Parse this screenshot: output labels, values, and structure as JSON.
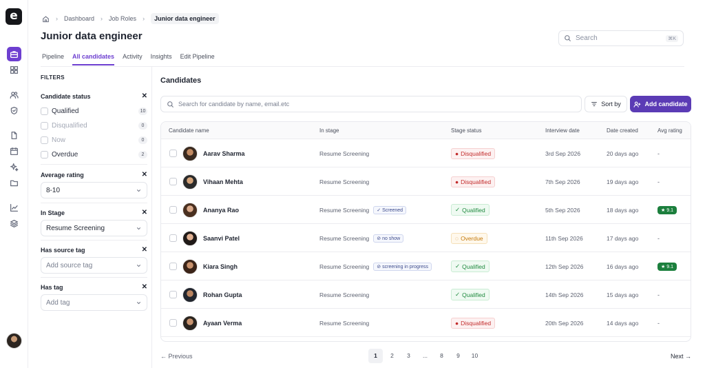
{
  "app": {
    "logo_letter": "e"
  },
  "rail": {
    "icons": [
      "briefcase-icon",
      "grid-icon",
      "users-icon",
      "shield-icon",
      "file-icon",
      "calendar-icon",
      "sparkle-icon",
      "folder-icon",
      "chart-icon",
      "layers-icon"
    ]
  },
  "breadcrumb": {
    "items": [
      "Dashboard",
      "Job Roles"
    ],
    "current": "Junior data engineer"
  },
  "page": {
    "title": "Junior data engineer"
  },
  "top_search": {
    "placeholder": "Search",
    "shortcut": "⌘K"
  },
  "tabs": [
    {
      "label": "Pipeline",
      "active": false
    },
    {
      "label": "All candidates",
      "active": true
    },
    {
      "label": "Activity",
      "active": false
    },
    {
      "label": "Insights",
      "active": false
    },
    {
      "label": "Edit Pipeline",
      "active": false
    }
  ],
  "filters": {
    "title": "FILTERS",
    "candidate_status": {
      "label": "Candidate status",
      "options": [
        {
          "label": "Qualified",
          "count": "10"
        },
        {
          "label": "Disqualified",
          "count": "0"
        },
        {
          "label": "Now",
          "count": "0"
        },
        {
          "label": "Overdue",
          "count": "2"
        }
      ]
    },
    "average_rating": {
      "label": "Average rating",
      "value": "8-10"
    },
    "in_stage": {
      "label": "In Stage",
      "value": "Resume Screening"
    },
    "source_tag": {
      "label": "Has source tag",
      "placeholder": "Add source tag"
    },
    "tag": {
      "label": "Has tag",
      "placeholder": "Add tag"
    }
  },
  "candidates": {
    "title": "Candidates",
    "search_placeholder": "Search for candidate by name, email.etc",
    "sort_label": "Sort by",
    "add_label": "Add candidate",
    "columns": [
      "Candidate name",
      "In stage",
      "Stage status",
      "Interview date",
      "Date created",
      "Avg rating"
    ],
    "rows": [
      {
        "name": "Aarav Sharma",
        "stage": "Resume Screening",
        "tag": "",
        "status": "Disqualified",
        "status_kind": "dq",
        "interview": "3rd Sep 2026",
        "created": "20 days ago",
        "rating": "-"
      },
      {
        "name": "Vihaan Mehta",
        "stage": "Resume Screening",
        "tag": "",
        "status": "Disqualified",
        "status_kind": "dq",
        "interview": "7th Sep 2026",
        "created": "19 days ago",
        "rating": "-"
      },
      {
        "name": "Ananya Rao",
        "stage": "Resume Screening",
        "tag": "Screened",
        "status": "Qualified",
        "status_kind": "ok",
        "interview": "5th Sep 2026",
        "created": "18 days ago",
        "rating": "9.1"
      },
      {
        "name": "Saanvi Patel",
        "stage": "Resume Screening",
        "tag": "no show",
        "status": "Overdue",
        "status_kind": "od",
        "interview": "11th Sep 2026",
        "created": "17 days ago",
        "rating": "-"
      },
      {
        "name": "Kiara Singh",
        "stage": "Resume Screening",
        "tag": "screening in progress",
        "status": "Qualified",
        "status_kind": "ok",
        "interview": "12th Sep 2026",
        "created": "16 days ago",
        "rating": "9.1"
      },
      {
        "name": "Rohan Gupta",
        "stage": "Resume Screening",
        "tag": "",
        "status": "Qualified",
        "status_kind": "ok",
        "interview": "14th Sep 2026",
        "created": "15 days ago",
        "rating": "-"
      },
      {
        "name": "Ayaan Verma",
        "stage": "Resume Screening",
        "tag": "",
        "status": "Disqualified",
        "status_kind": "dq",
        "interview": "20th Sep 2026",
        "created": "14 days ago",
        "rating": "-"
      }
    ]
  },
  "pagination": {
    "prev": "Previous",
    "next": "Next",
    "pages": [
      "1",
      "2",
      "3",
      "...",
      "8",
      "9",
      "10"
    ],
    "current": "1"
  }
}
